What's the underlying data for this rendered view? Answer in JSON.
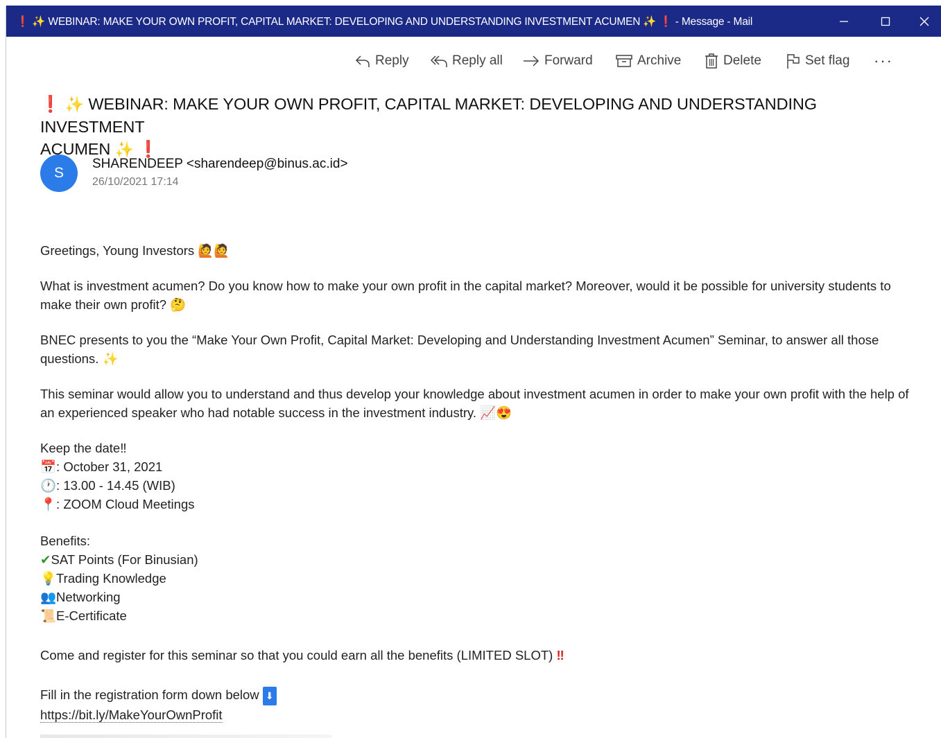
{
  "window": {
    "title": "❗ ✨ WEBINAR: MAKE YOUR OWN PROFIT, CAPITAL MARKET: DEVELOPING AND UNDERSTANDING INVESTMENT ACUMEN ✨ ❗ - Message - Mail",
    "accent_color": "#1b2a86"
  },
  "toolbar": {
    "reply": "Reply",
    "reply_all": "Reply all",
    "forward": "Forward",
    "archive": "Archive",
    "delete": "Delete",
    "set_flag": "Set flag",
    "more": "···"
  },
  "message": {
    "subject_line1": "WEBINAR: MAKE YOUR OWN PROFIT, CAPITAL MARKET: DEVELOPING AND UNDERSTANDING INVESTMENT",
    "subject_line2": "ACUMEN",
    "avatar_initial": "S",
    "avatar_color": "#2b7be8",
    "sender": "SHARENDEEP <sharendeep@binus.ac.id>",
    "date": "26/10/2021 17:14"
  },
  "body": {
    "greeting": "Greetings, Young Investors",
    "p1": "What is investment acumen? Do you know how to make your own profit in the capital market? Moreover, would it be possible for university students to make their own profit?",
    "p2": "BNEC presents to you the “Make Your Own Profit, Capital Market: Developing and Understanding Investment Acumen” Seminar, to answer all those questions.",
    "p3": "This seminar would allow you to understand and thus develop your knowledge about investment acumen in order to make your own profit with the help of an experienced speaker who had notable success in the investment industry.",
    "keep_date": "Keep the date‼",
    "date_line": ": October 31, 2021",
    "time_line": ": 13.00 - 14.45 (WIB)",
    "place_line": ": ZOOM Cloud Meetings",
    "benefits_title": "Benefits:",
    "benefit1": "SAT Points (For Binusian)",
    "benefit2": "Trading Knowledge",
    "benefit3": "Networking",
    "benefit4": "E-Certificate",
    "register": "Come and register for this seminar so that you could earn all the benefits (LIMITED SLOT)",
    "form": "Fill in the registration form down below",
    "link": "https://bit.ly/MakeYourOwnProfit"
  }
}
